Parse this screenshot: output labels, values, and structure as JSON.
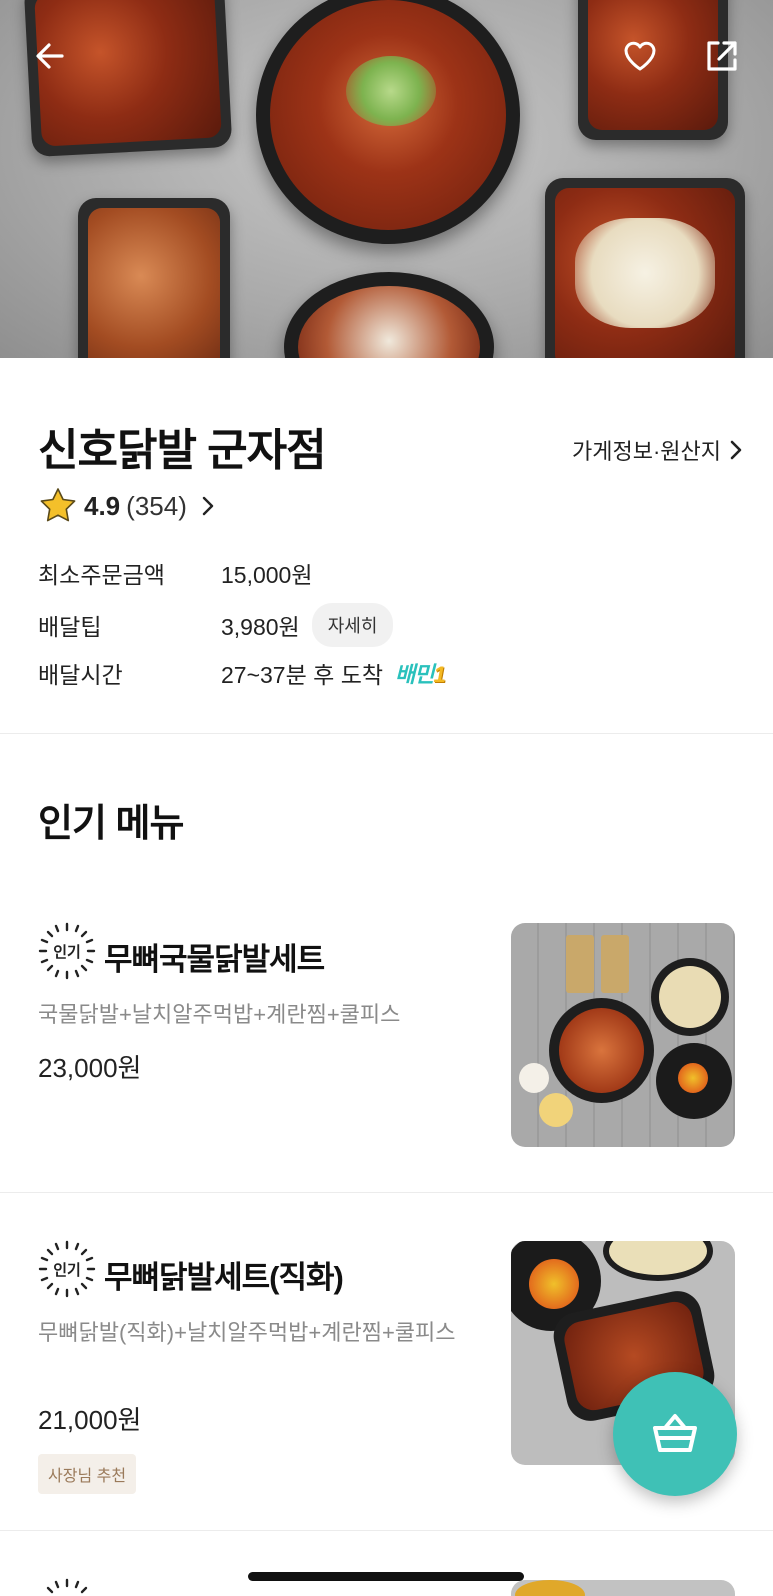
{
  "hero": {
    "icons": [
      "back-arrow-icon",
      "heart-icon",
      "share-icon"
    ]
  },
  "store": {
    "name": "신호닭발 군자점",
    "info_link": "가게정보·원산지",
    "rating": "4.9",
    "review_count": "(354)",
    "rows": [
      {
        "label": "최소주문금액",
        "value": "15,000원"
      },
      {
        "label": "배달팁",
        "value": "3,980원",
        "chip": "자세히"
      },
      {
        "label": "배달시간",
        "value": "27~37분 후 도착",
        "badge": "배민",
        "badge_num": "1"
      }
    ]
  },
  "popular": {
    "title": "인기 메뉴",
    "badge_text": "인기",
    "items": [
      {
        "name": "무뼈국물닭발세트",
        "desc": "국물닭발+날치알주먹밥+계란찜+쿨피스",
        "price": "23,000원"
      },
      {
        "name": "무뼈닭발세트(직화)",
        "desc": "무뼈닭발(직화)+날치알주먹밥+계란찜+쿨피스",
        "price": "21,000원",
        "tag": "사장님 추천"
      }
    ]
  },
  "colors": {
    "accent": "#3fc1b6",
    "star": "#f4c02a"
  }
}
